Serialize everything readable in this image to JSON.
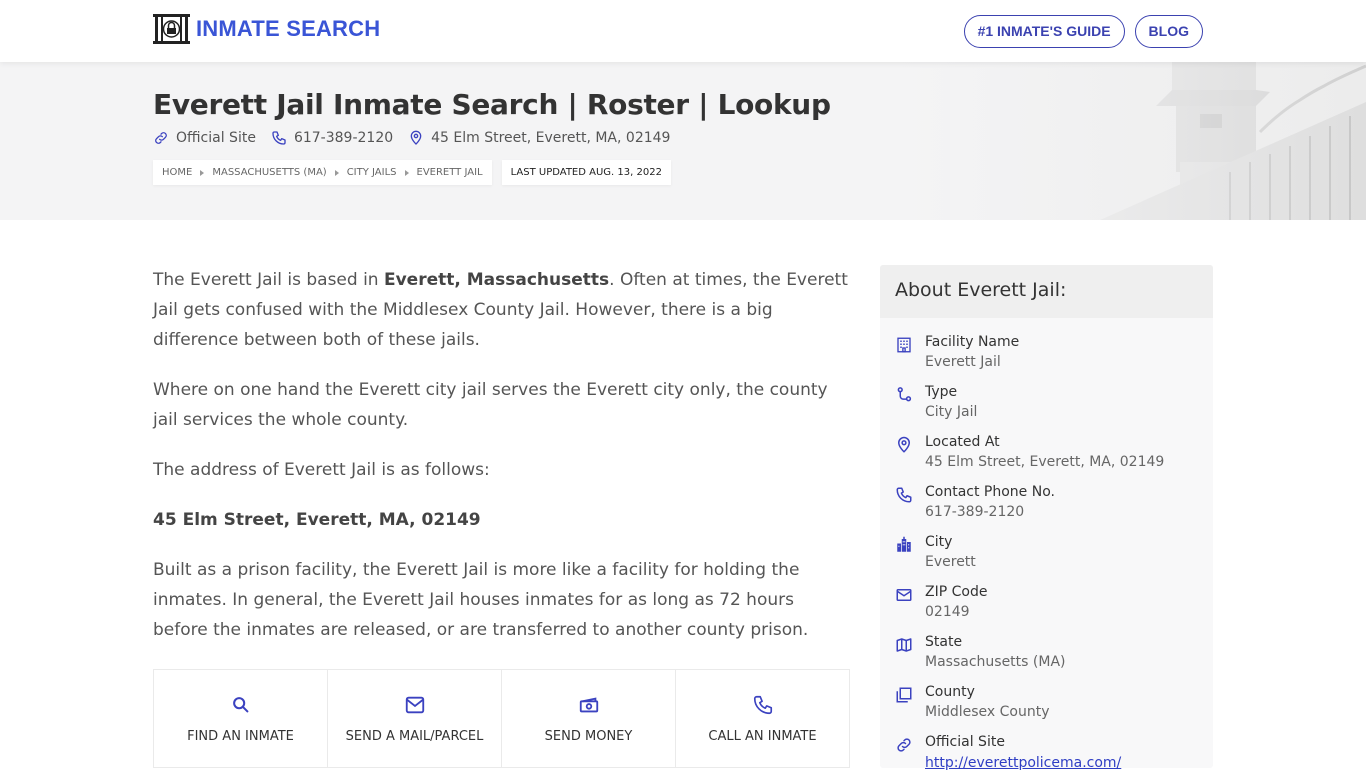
{
  "header": {
    "logo_text": "INMATE SEARCH",
    "nav": [
      {
        "label": "#1 INMATE'S GUIDE"
      },
      {
        "label": "BLOG"
      }
    ]
  },
  "hero": {
    "title": "Everett Jail Inmate Search | Roster | Lookup",
    "official_site_label": "Official Site",
    "phone": "617-389-2120",
    "address": "45 Elm Street, Everett, MA, 02149",
    "breadcrumbs": [
      "HOME",
      "MASSACHUSETTS (MA)",
      "CITY JAILS",
      "EVERETT JAIL"
    ],
    "last_updated": "LAST UPDATED AUG. 13, 2022"
  },
  "content": {
    "p1_pre": "The Everett Jail is based in ",
    "p1_bold": "Everett, Massachusetts",
    "p1_post": ". Often at times, the Everett Jail gets confused with the Middlesex County Jail. However, there is a big difference between both of these jails.",
    "p2": "Where on one hand the Everett city jail serves the Everett city only, the county jail services the whole county.",
    "p3": "The address of Everett Jail is as follows:",
    "p4_bold": "45 Elm Street, Everett, MA, 02149",
    "p5": "Built as a prison facility, the Everett Jail is more like a facility for holding the inmates. In general, the Everett Jail houses inmates for as long as 72 hours before the inmates are released, or are transferred to another county prison."
  },
  "services": [
    {
      "label": "FIND AN INMATE",
      "icon": "search-icon"
    },
    {
      "label": "SEND A MAIL/PARCEL",
      "icon": "mail-icon"
    },
    {
      "label": "SEND MONEY",
      "icon": "money-icon"
    },
    {
      "label": "CALL AN INMATE",
      "icon": "phone-icon"
    }
  ],
  "about": {
    "title": "About Everett Jail:",
    "facts": [
      {
        "label": "Facility Name",
        "value": "Everett Jail",
        "icon": "building-icon"
      },
      {
        "label": "Type",
        "value": "City Jail",
        "icon": "route-icon"
      },
      {
        "label": "Located At",
        "value": "45 Elm Street, Everett, MA, 02149",
        "icon": "location-pin-icon"
      },
      {
        "label": "Contact Phone No.",
        "value": "617-389-2120",
        "icon": "phone-icon"
      },
      {
        "label": "City",
        "value": "Everett",
        "icon": "city-icon"
      },
      {
        "label": "ZIP Code",
        "value": "02149",
        "icon": "mail-icon"
      },
      {
        "label": "State",
        "value": "Massachusetts (MA)",
        "icon": "map-icon"
      },
      {
        "label": "County",
        "value": "Middlesex County",
        "icon": "copy-icon"
      },
      {
        "label": "Official Site",
        "value": "http://everettpolicema.com/",
        "icon": "link-icon"
      }
    ]
  },
  "colors": {
    "accent": "#3a55d6",
    "nav_border": "#3b42b0",
    "icon": "#3b42c0",
    "hero_bg": "#f4f4f5"
  }
}
